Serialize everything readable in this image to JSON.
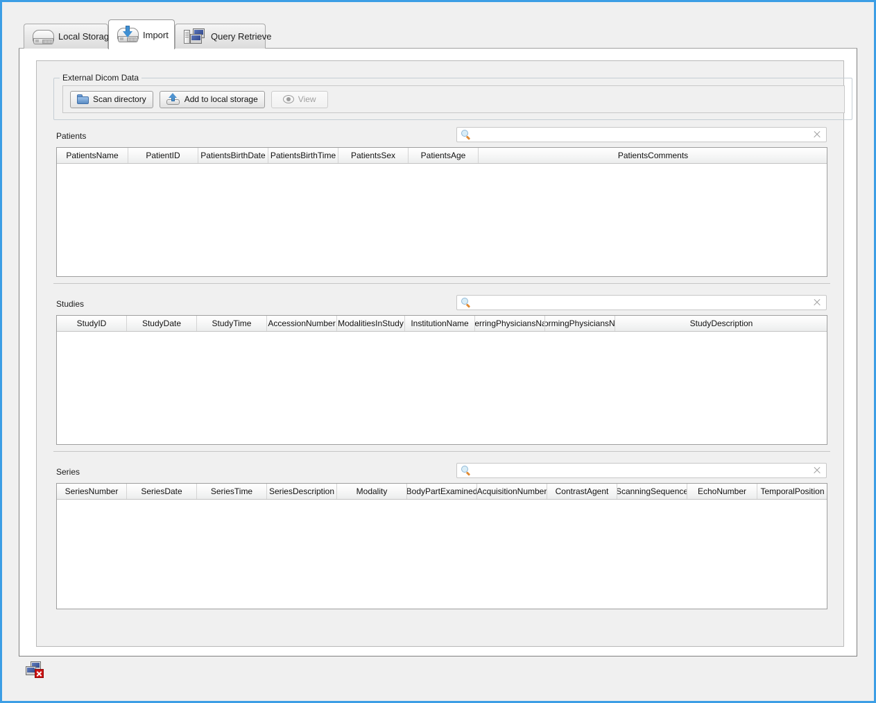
{
  "window": {
    "accent_color": "#3c9ee5",
    "background_color": "#f0f0f0"
  },
  "tabs": [
    {
      "label": "Local Storage",
      "icon": "hard-drive-icon",
      "selected": false
    },
    {
      "label": "Import",
      "icon": "hard-drive-download-icon",
      "selected": true
    },
    {
      "label": "Query Retrieve",
      "icon": "server-monitors-icon",
      "selected": false
    }
  ],
  "groupbox": {
    "title": "External Dicom Data",
    "buttons": [
      {
        "label": "Scan directory",
        "icon": "folder-icon",
        "enabled": true
      },
      {
        "label": "Add to local storage",
        "icon": "upload-icon",
        "enabled": true
      },
      {
        "label": "View",
        "icon": "eye-icon",
        "enabled": false
      }
    ]
  },
  "sections": [
    {
      "label": "Patients",
      "search": {
        "value": "",
        "placeholder": "",
        "icon": "search-icon",
        "clear_icon": "clear-icon"
      },
      "columns": [
        "PatientsName",
        "PatientID",
        "PatientsBirthDate",
        "PatientsBirthTime",
        "PatientsSex",
        "PatientsAge",
        "PatientsComments"
      ],
      "rows": []
    },
    {
      "label": "Studies",
      "search": {
        "value": "",
        "placeholder": "",
        "icon": "search-icon",
        "clear_icon": "clear-icon"
      },
      "columns": [
        "StudyID",
        "StudyDate",
        "StudyTime",
        "AccessionNumber",
        "ModalitiesInStudy",
        "InstitutionName",
        "ReferringPhysiciansName",
        "PerformingPhysiciansName",
        "StudyDescription"
      ],
      "rows": []
    },
    {
      "label": "Series",
      "search": {
        "value": "",
        "placeholder": "",
        "icon": "search-icon",
        "clear_icon": "clear-icon"
      },
      "columns": [
        "SeriesNumber",
        "SeriesDate",
        "SeriesTime",
        "SeriesDescription",
        "Modality",
        "BodyPartExamined",
        "AcquisitionNumber",
        "ContrastAgent",
        "ScanningSequence",
        "EchoNumber",
        "TemporalPosition"
      ],
      "rows": []
    }
  ],
  "statusbar": {
    "icon": "network-disconnected-icon"
  }
}
